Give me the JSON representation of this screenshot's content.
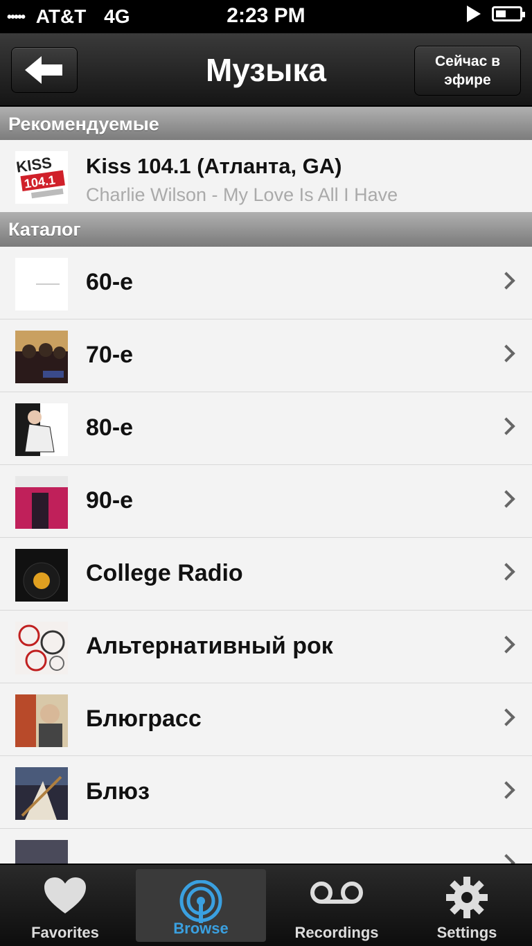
{
  "status_bar": {
    "signal": "•••••",
    "carrier": "AT&T",
    "network": "4G",
    "time": "2:23 PM"
  },
  "nav": {
    "title": "Музыка",
    "now_playing_line1": "Сейчас в",
    "now_playing_line2": "эфире"
  },
  "featured": {
    "header": "Рекомендуемые",
    "station_title": "Kiss 104.1 (Атланта, GA)",
    "now_playing": "Charlie Wilson - My Love Is All I Have",
    "logo_text": "KISS 104.1"
  },
  "catalog": {
    "header": "Каталог",
    "items": [
      {
        "label": "60-е"
      },
      {
        "label": "70-е"
      },
      {
        "label": "80-е"
      },
      {
        "label": "90-е"
      },
      {
        "label": "College Radio"
      },
      {
        "label": "Альтернативный рок"
      },
      {
        "label": "Блюграсс"
      },
      {
        "label": "Блюз"
      }
    ]
  },
  "tabs": [
    {
      "label": "Favorites",
      "icon": "heart-icon"
    },
    {
      "label": "Browse",
      "icon": "broadcast-icon"
    },
    {
      "label": "Recordings",
      "icon": "voicemail-icon"
    },
    {
      "label": "Settings",
      "icon": "gear-icon"
    }
  ],
  "colors": {
    "accent": "#3aa0e0",
    "navbar": "#1f1f1f",
    "section_header": "#8f8f8f"
  }
}
